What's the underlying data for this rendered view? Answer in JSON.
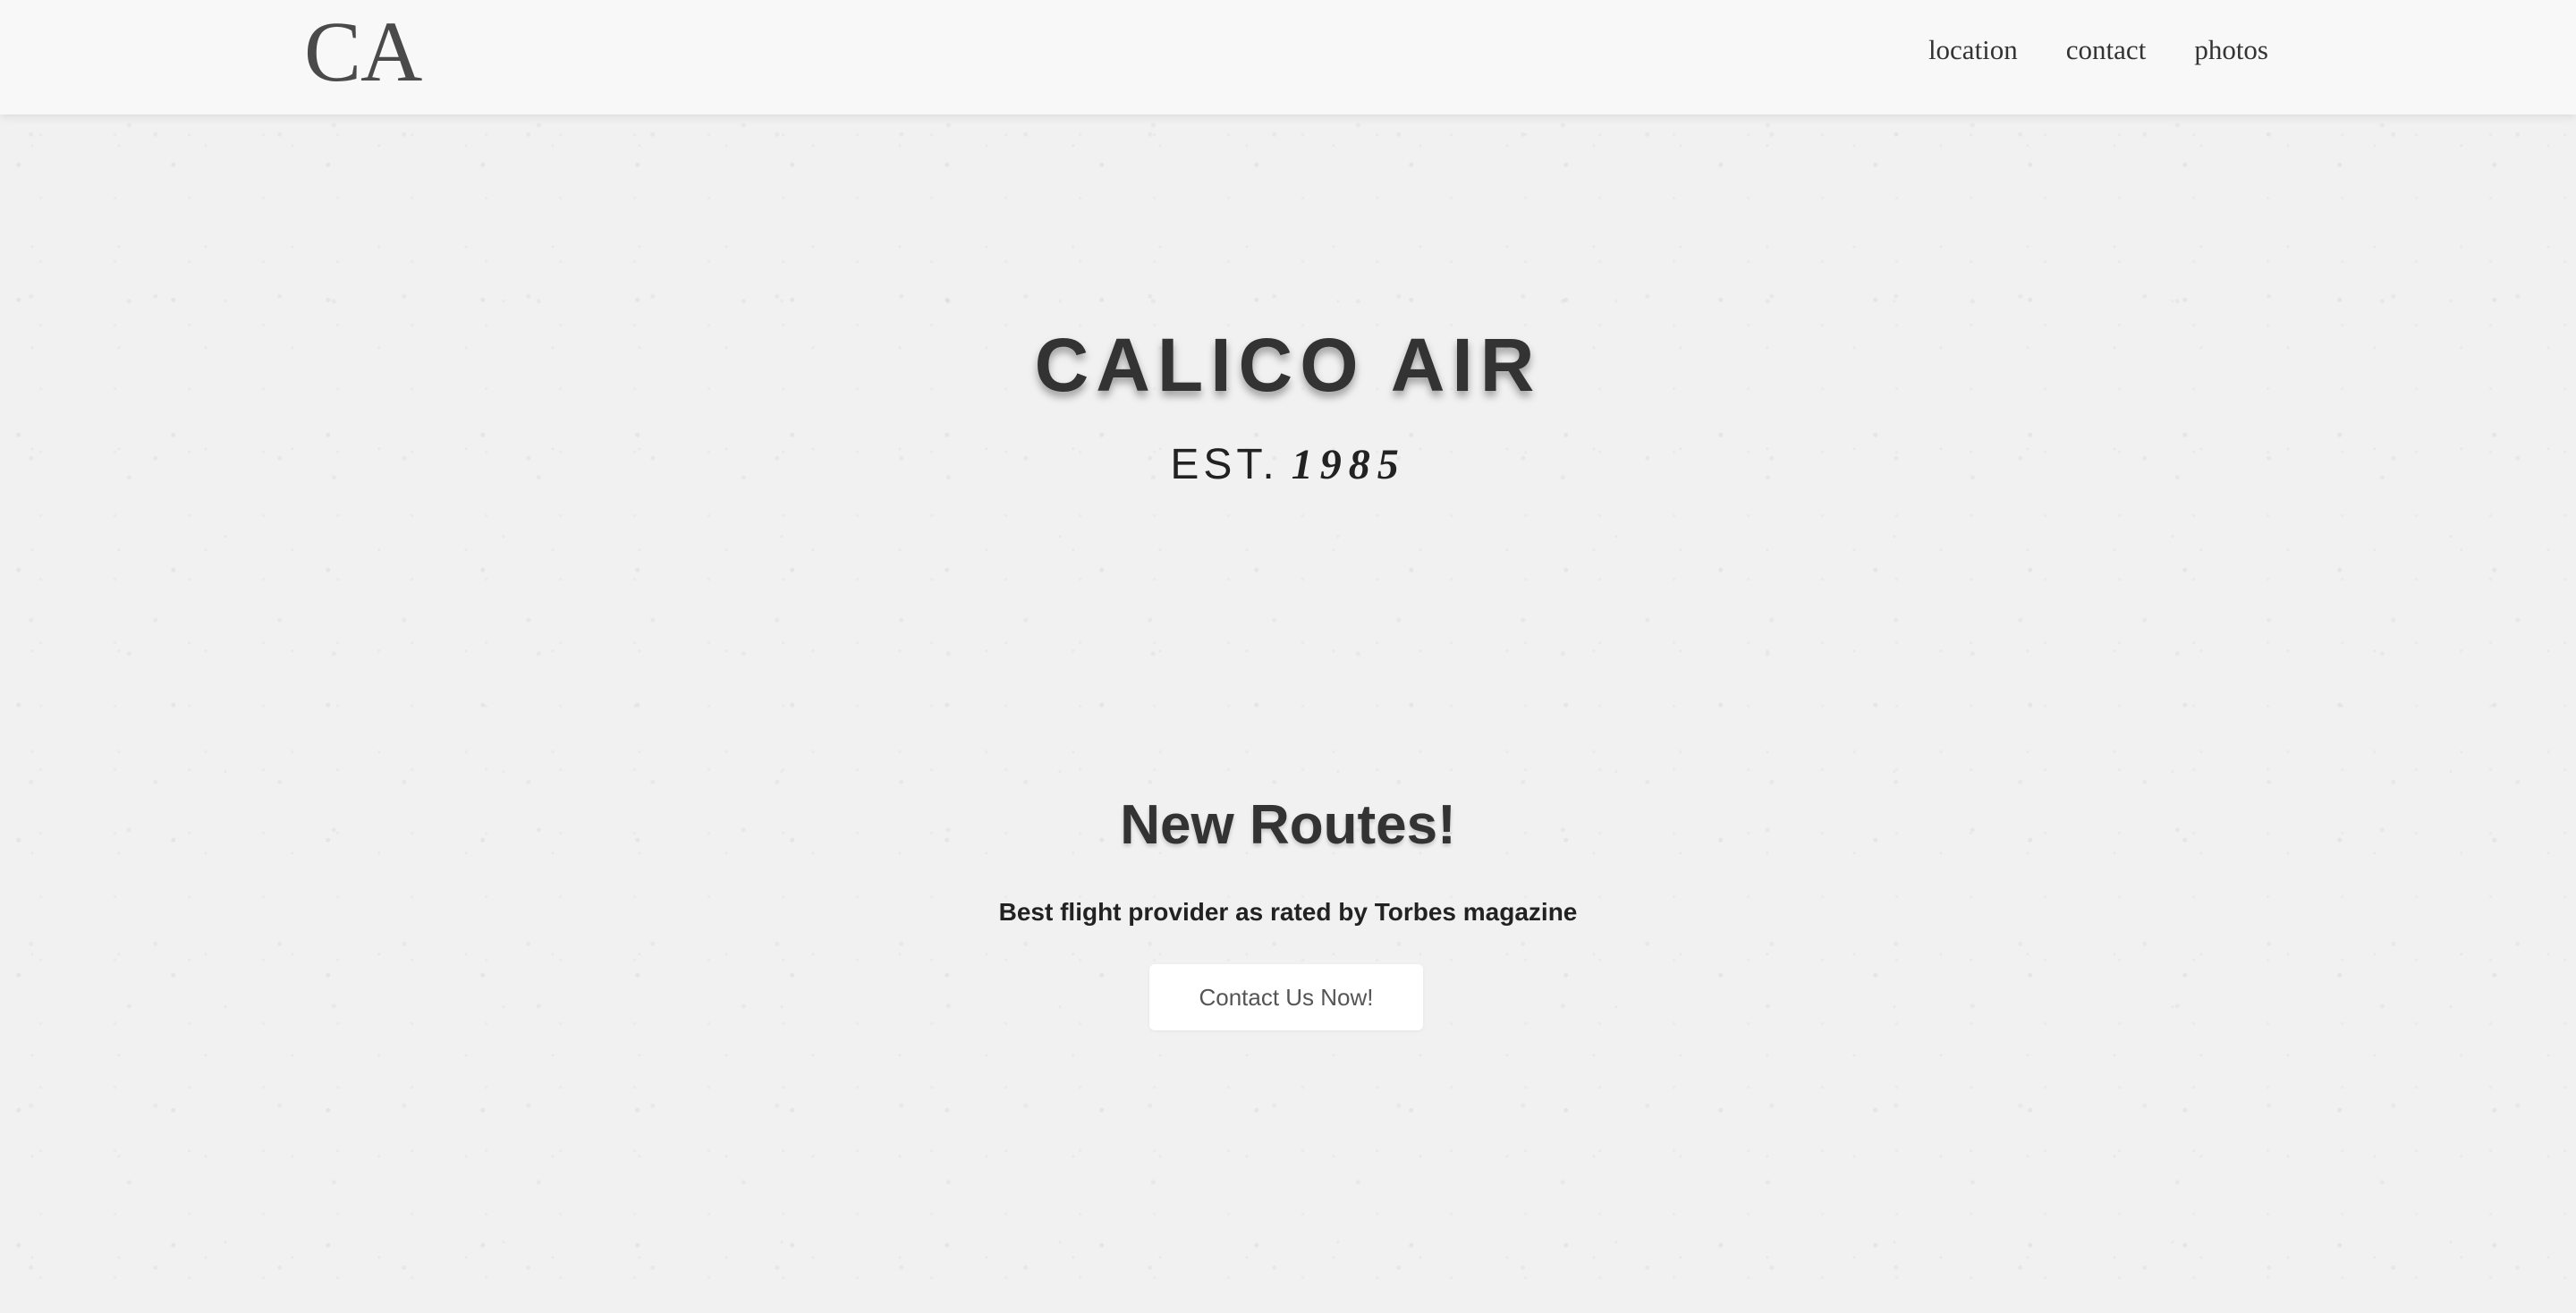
{
  "header": {
    "brand": "CA",
    "nav": [
      "location",
      "contact",
      "photos"
    ]
  },
  "hero": {
    "title": "CALICO AIR",
    "est_label": "EST.",
    "year": "1985"
  },
  "promo": {
    "title": "New Routes!",
    "subtitle": "Best flight provider as rated by Torbes magazine",
    "button_label": "Contact Us Now!"
  }
}
